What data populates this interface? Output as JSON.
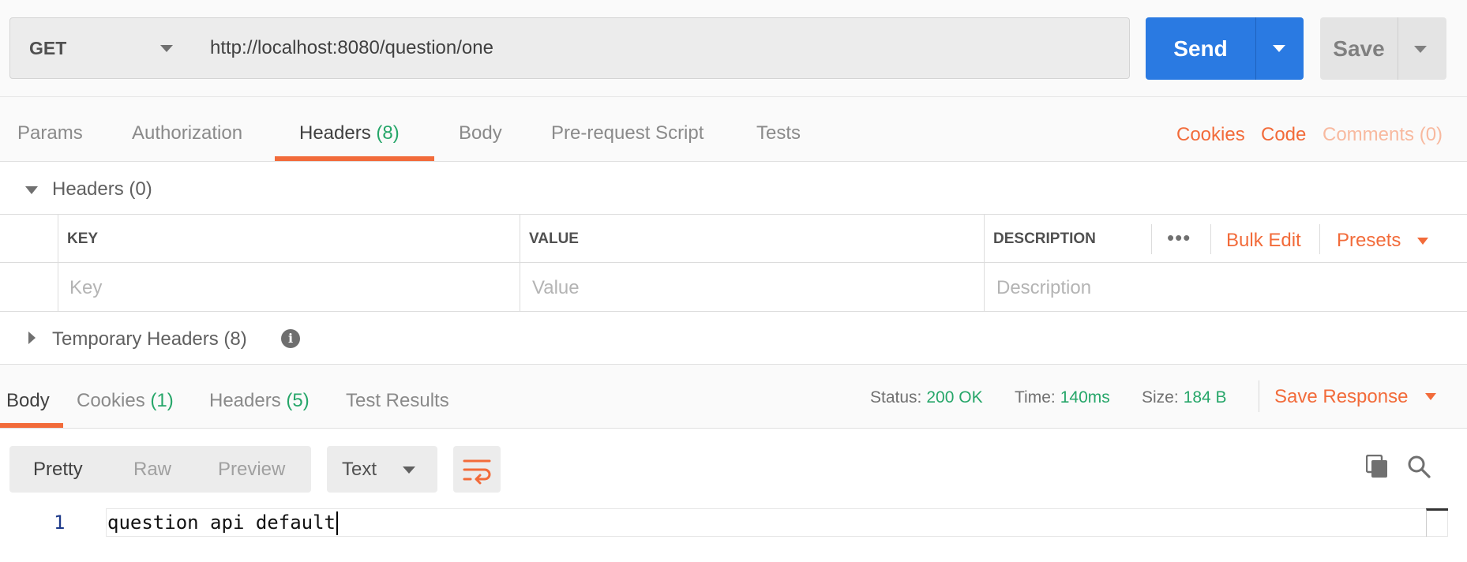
{
  "request": {
    "method": "GET",
    "url": "http://localhost:8080/question/one",
    "send_label": "Send",
    "save_label": "Save"
  },
  "request_tabs": {
    "params": "Params",
    "authorization": "Authorization",
    "headers": {
      "label": "Headers",
      "count": "(8)"
    },
    "body": "Body",
    "prerequest": "Pre-request Script",
    "tests": "Tests",
    "active": "Headers"
  },
  "request_links": {
    "cookies": "Cookies",
    "code": "Code",
    "comments": "Comments (0)"
  },
  "headers_section": {
    "title": "Headers",
    "count": "(0)",
    "columns": {
      "key": "KEY",
      "value": "VALUE",
      "description": "DESCRIPTION"
    },
    "placeholders": {
      "key": "Key",
      "value": "Value",
      "description": "Description"
    },
    "more": "•••",
    "bulk_edit": "Bulk Edit",
    "presets": "Presets"
  },
  "temporary_headers": {
    "title": "Temporary Headers",
    "count": "(8)",
    "info_glyph": "i"
  },
  "response_tabs": {
    "body": "Body",
    "cookies": {
      "label": "Cookies",
      "count": "(1)"
    },
    "headers": {
      "label": "Headers",
      "count": "(5)"
    },
    "test_results": "Test Results",
    "active": "Body"
  },
  "response_stats": {
    "status_label": "Status:",
    "status_value": "200 OK",
    "time_label": "Time:",
    "time_value": "140ms",
    "size_label": "Size:",
    "size_value": "184 B"
  },
  "save_response": "Save Response",
  "view_modes": {
    "pretty": "Pretty",
    "raw": "Raw",
    "preview": "Preview",
    "active": "Pretty"
  },
  "format": "Text",
  "icons": [
    "chevron-down-icon",
    "info-icon",
    "wrap-lines-icon",
    "copy-icon",
    "search-icon"
  ],
  "colors": {
    "accent": "#f26b3a",
    "send": "#2a7ae2",
    "success": "#26a669"
  },
  "code": {
    "line_number": "1",
    "text": "question api default"
  }
}
